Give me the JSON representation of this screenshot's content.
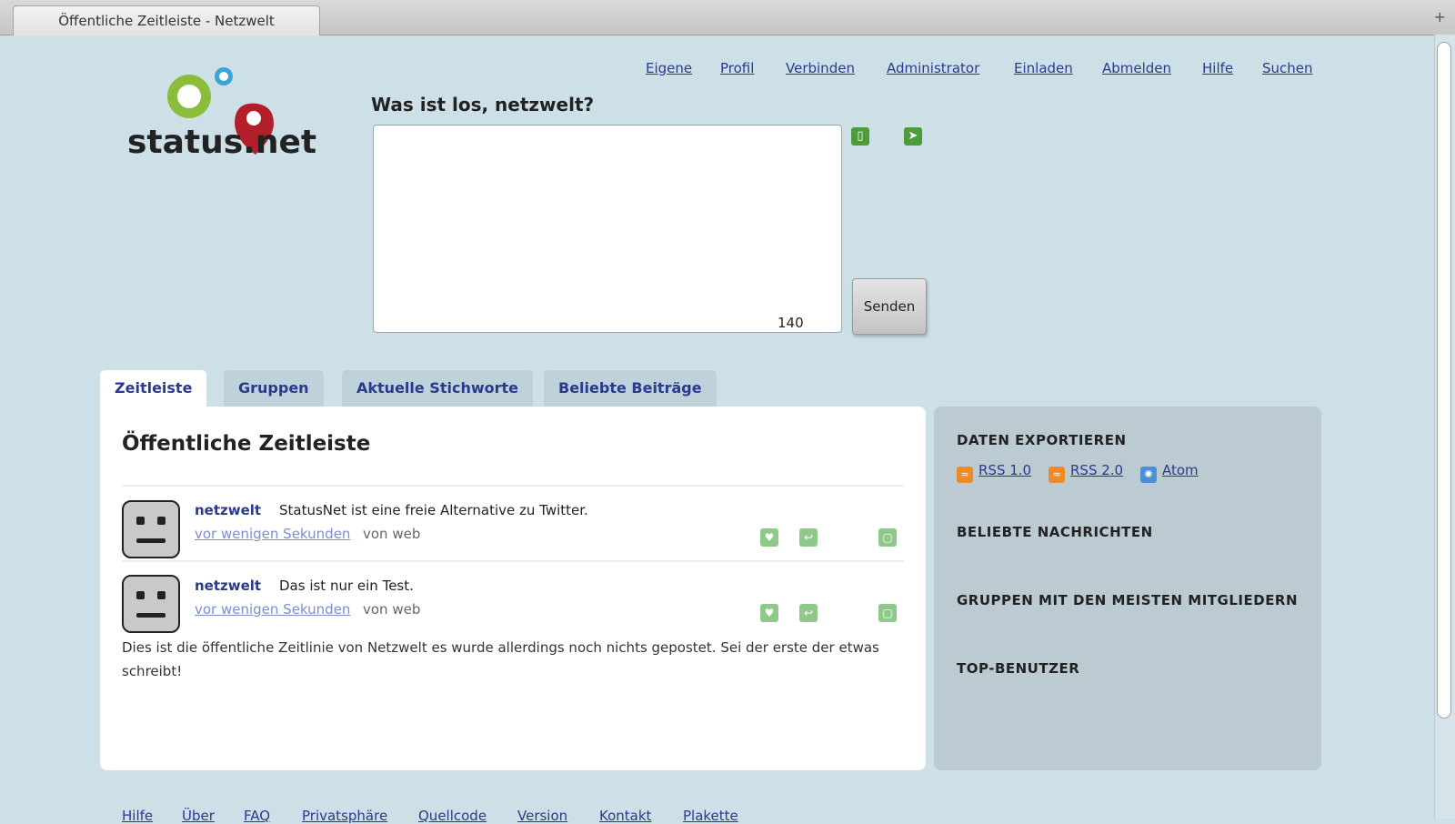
{
  "browser": {
    "tab_title": "Öffentliche Zeitleiste - Netzwelt",
    "new_tab_label": "+"
  },
  "logo": {
    "text": "status.net"
  },
  "nav": [
    "Eigene",
    "Profil",
    "Verbinden",
    "Administrator",
    "Einladen",
    "Abmelden",
    "Hilfe",
    "Suchen"
  ],
  "form": {
    "label": "Was ist los, netzwelt?",
    "value": "",
    "counter": "140",
    "send_label": "Senden"
  },
  "tabs": [
    "Zeitleiste",
    "Gruppen",
    "Aktuelle Stichworte",
    "Beliebte Beiträge"
  ],
  "page_title": "Öffentliche Zeitleiste",
  "notices": [
    {
      "author": "netzwelt",
      "text": "StatusNet ist eine freie Alternative zu Twitter.",
      "time": "vor wenigen Sekunden",
      "source": "von web"
    },
    {
      "author": "netzwelt",
      "text": "Das ist nur ein Test.",
      "time": "vor wenigen Sekunden",
      "source": "von web"
    }
  ],
  "empty_message": "Dies ist die öffentliche Zeitlinie von Netzwelt es wurde allerdings noch nichts gepostet. Sei der erste der etwas schreibt!",
  "aside": {
    "export_heading": "DATEN EXPORTIEREN",
    "feeds": [
      "RSS 1.0",
      "RSS 2.0",
      "Atom"
    ],
    "popular_heading": "BELIEBTE NACHRICHTEN",
    "groups_heading": "GRUPPEN MIT DEN MEISTEN MITGLIEDERN",
    "top_users_heading": "TOP-BENUTZER"
  },
  "footer": [
    "Hilfe",
    "Über",
    "FAQ",
    "Privatsphäre",
    "Quellcode",
    "Version",
    "Kontakt",
    "Plakette"
  ],
  "colors": {
    "page_bg": "#cde0e8",
    "link": "#2a3a8c",
    "aside_bg": "#bccbd2",
    "action_green": "#8fc98a"
  }
}
